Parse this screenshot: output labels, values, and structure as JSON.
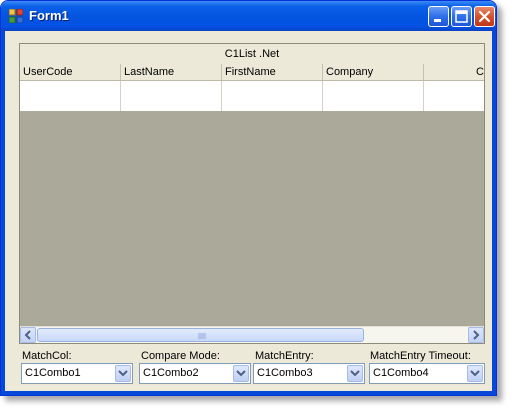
{
  "window": {
    "title": "Form1"
  },
  "list": {
    "caption": "C1List .Net",
    "columns": [
      "UserCode",
      "LastName",
      "FirstName",
      "Company",
      "C"
    ]
  },
  "controls": [
    {
      "label": "MatchCol:",
      "value": "C1Combo1"
    },
    {
      "label": "Compare Mode:",
      "value": "C1Combo2"
    },
    {
      "label": "MatchEntry:",
      "value": "C1Combo3"
    },
    {
      "label": "MatchEntry Timeout:",
      "value": "C1Combo4"
    }
  ],
  "icons": {
    "app": "form-window-icon",
    "minimize": "minimize-icon",
    "maximize": "maximize-icon",
    "close": "close-icon",
    "scroll_left": "chevron-left-icon",
    "scroll_right": "chevron-right-icon",
    "dropdown": "chevron-down-icon"
  },
  "colors": {
    "titlebar": "#0354df",
    "list_background": "#aaa99a",
    "window_background": "#ece9d8"
  }
}
